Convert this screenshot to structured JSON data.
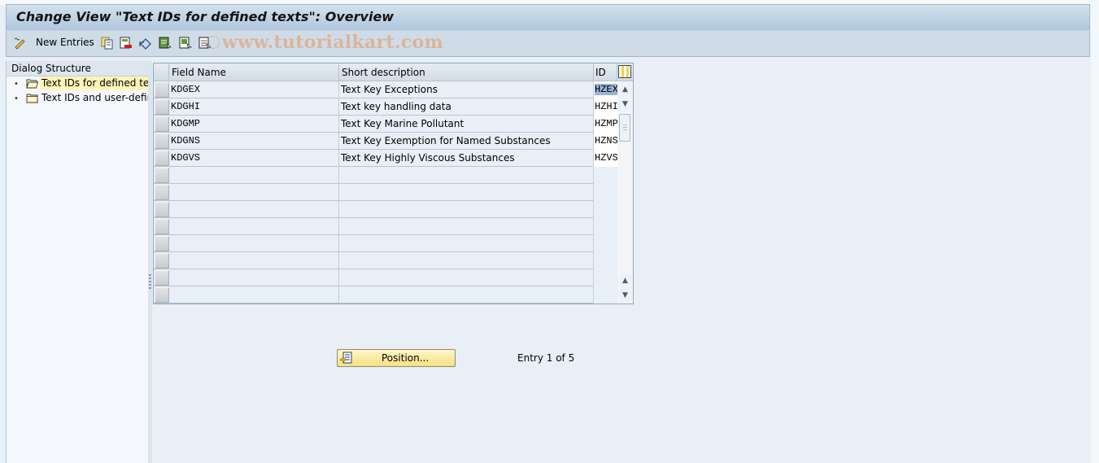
{
  "window": {
    "title": "Change View \"Text IDs for defined texts\": Overview"
  },
  "toolbar": {
    "items": [
      {
        "icon": "display-change-icon",
        "label": ""
      },
      {
        "icon": "new-entries",
        "label": "New Entries"
      },
      {
        "icon": "copy-as-icon",
        "label": ""
      },
      {
        "icon": "delete-icon",
        "label": ""
      },
      {
        "icon": "undo-change-icon",
        "label": ""
      },
      {
        "icon": "select-all-icon",
        "label": ""
      },
      {
        "icon": "select-block-icon",
        "label": ""
      },
      {
        "icon": "deselect-all-icon",
        "label": ""
      }
    ],
    "watermark": "www.tutorialkart.com"
  },
  "dialog_structure": {
    "header": "Dialog Structure",
    "items": [
      {
        "label": "Text IDs for defined texts",
        "selected": true,
        "folder": "open"
      },
      {
        "label": "Text IDs and user-defined texts",
        "selected": false,
        "folder": "closed"
      }
    ]
  },
  "table": {
    "columns": [
      "Field Name",
      "Short description",
      "ID"
    ],
    "rows": [
      {
        "field_name": "KDGEX",
        "short_description": "Text Key Exceptions",
        "id": "HZEX"
      },
      {
        "field_name": "KDGHI",
        "short_description": "Text key handling data",
        "id": "HZHI"
      },
      {
        "field_name": "KDGMP",
        "short_description": "Text Key Marine Pollutant",
        "id": "HZMP"
      },
      {
        "field_name": "KDGNS",
        "short_description": "Text Key Exemption for Named Substances",
        "id": "HZNS"
      },
      {
        "field_name": "KDGVS",
        "short_description": "Text Key Highly Viscous Substances",
        "id": "HZVS"
      }
    ],
    "empty_rows": 8
  },
  "footer": {
    "position_button": "Position...",
    "entry_info": "Entry 1 of 5"
  }
}
